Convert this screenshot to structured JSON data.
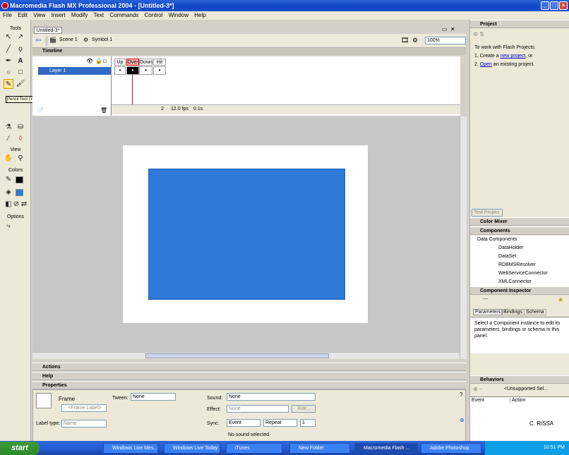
{
  "window": {
    "title": "Macromedia Flash MX Professional 2004 - [Untitled-3*]"
  },
  "menu": [
    "File",
    "Edit",
    "View",
    "Insert",
    "Modify",
    "Text",
    "Commands",
    "Control",
    "Window",
    "Help"
  ],
  "tools": {
    "header": "Tools",
    "view_label": "View",
    "colors_label": "Colors",
    "options_label": "Options",
    "tooltip": "Pencil Tool (Y)"
  },
  "document": {
    "tab": "Untitled-3*",
    "scene": "Scene 1",
    "symbol": "Symbol 1",
    "zoom": "100%"
  },
  "timeline": {
    "header": "Timeline",
    "layer": "Layer 1",
    "frames": [
      "Up",
      "Over",
      "Down",
      "Hit"
    ],
    "current_frame": "2",
    "fps": "12.0 fps",
    "time": "0.1s"
  },
  "panels": {
    "actions": "Actions",
    "help": "Help",
    "properties": "Properties"
  },
  "properties": {
    "frame": "Frame",
    "frame_label_placeholder": "<Frame Label>",
    "tween_label": "Tween:",
    "tween": "None",
    "sound_label": "Sound:",
    "sound": "None",
    "effect_label": "Effect:",
    "effect": "None",
    "edit_btn": "Edit...",
    "label_type_label": "Label type:",
    "label_type": "Name",
    "sync_label": "Sync:",
    "sync": "Event",
    "repeat": "Repeat",
    "repeat_count": "1",
    "no_sound": "No sound selected."
  },
  "project": {
    "header": "Project",
    "intro": "To work with Flash Projects:",
    "item1_pre": "1. Create a ",
    "item1_link": "new project",
    "item1_post": ", or",
    "item2_pre": "2. ",
    "item2_link": "Open",
    "item2_post": " an existing project.",
    "test_btn": "Test Project"
  },
  "color_mixer": "Color Mixer",
  "components": {
    "header": "Components",
    "category": "Data Components",
    "items": [
      "DataHolder",
      "DataSet",
      "RDBMSResolver",
      "WebServiceConnector",
      "XMLConnector"
    ]
  },
  "inspector": {
    "header": "Component Inspector",
    "value": "---",
    "tabs": [
      "Parameters",
      "Bindings",
      "Schema"
    ],
    "message": "Select a Component instance to edit its parameters, bindings or schema in this panel."
  },
  "behaviors": {
    "header": "Behaviors",
    "dropdown": "<Unsupported Sel...",
    "col1": "Event",
    "col2": "Action"
  },
  "watermark": "C. RISSA",
  "taskbar": {
    "start": "start",
    "apps": [
      "Windows Live Mes...",
      "Windows Live Today",
      "iTunes",
      "New Folder",
      "Macromedia Flash ...",
      "Adobe Photoshop"
    ],
    "time": "10:51 PM"
  }
}
